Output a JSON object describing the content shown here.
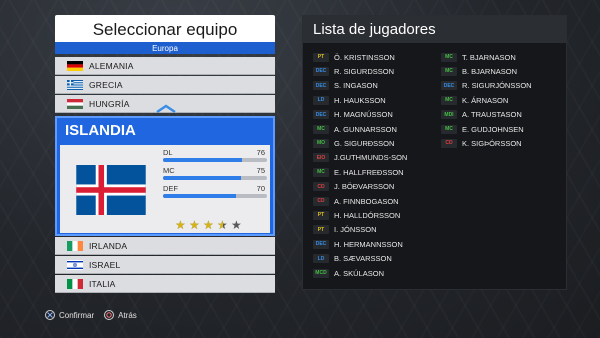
{
  "left_panel": {
    "title": "Seleccionar equipo",
    "region": "Europa",
    "teams_above": [
      {
        "name": "ALEMANIA",
        "flag": "germany"
      },
      {
        "name": "GRECIA",
        "flag": "greece"
      },
      {
        "name": "HUNGRÍA",
        "flag": "hungary"
      }
    ],
    "teams_below": [
      {
        "name": "IRLANDA",
        "flag": "ireland"
      },
      {
        "name": "ISRAEL",
        "flag": "israel"
      },
      {
        "name": "ITALIA",
        "flag": "italy"
      }
    ],
    "selected": {
      "name": "ISLANDIA",
      "flag": "iceland",
      "stats": [
        {
          "label": "DL",
          "value": "76",
          "level": 76
        },
        {
          "label": "MC",
          "value": "75",
          "level": 75
        },
        {
          "label": "DEF",
          "value": "70",
          "level": 70
        }
      ],
      "stars_rating": 3.5,
      "stars_max": 5
    }
  },
  "right_panel": {
    "title": "Lista de jugadores",
    "players_left": [
      {
        "pos": "PT",
        "name": "Ö. KRISTINSSON",
        "color": "#e0c020"
      },
      {
        "pos": "DEC",
        "name": "R. SIGURDSSON",
        "color": "#3a8ee6"
      },
      {
        "pos": "DEC",
        "name": "S. INGASON",
        "color": "#3a8ee6"
      },
      {
        "pos": "LD",
        "name": "H. HAUKSSON",
        "color": "#3a8ee6"
      },
      {
        "pos": "DEC",
        "name": "H. MAGNÚSSON",
        "color": "#3a8ee6"
      },
      {
        "pos": "MC",
        "name": "A. GUNNARSSON",
        "color": "#43c043"
      },
      {
        "pos": "MO",
        "name": "G. SIGURÐSSON",
        "color": "#43c043"
      },
      {
        "pos": "EIO",
        "name": "J.GUTHMUNDS-SON",
        "color": "#e04040"
      },
      {
        "pos": "MC",
        "name": "E. HALLFREÐSSON",
        "color": "#43c043"
      },
      {
        "pos": "CD",
        "name": "J. BÖÐVARSSON",
        "color": "#e04040"
      },
      {
        "pos": "CD",
        "name": "A. FINNBOGASON",
        "color": "#e04040"
      },
      {
        "pos": "PT",
        "name": "H. HALLDÓRSSON",
        "color": "#e0c020"
      },
      {
        "pos": "PT",
        "name": "I. JÓNSSON",
        "color": "#e0c020"
      },
      {
        "pos": "DEC",
        "name": "H. HERMANNSSON",
        "color": "#3a8ee6"
      },
      {
        "pos": "LD",
        "name": "B. SÆVARSSON",
        "color": "#3a8ee6"
      },
      {
        "pos": "MCD",
        "name": "A. SKÚLASON",
        "color": "#43c043"
      }
    ],
    "players_right": [
      {
        "pos": "MC",
        "name": "T. BJARNASON",
        "color": "#43c043"
      },
      {
        "pos": "MC",
        "name": "B. BJARNASON",
        "color": "#43c043"
      },
      {
        "pos": "DEC",
        "name": "R. SIGURJÓNSSON",
        "color": "#3a8ee6"
      },
      {
        "pos": "MC",
        "name": "K. ÁRNASON",
        "color": "#43c043"
      },
      {
        "pos": "MDI",
        "name": "A. TRAUSTASON",
        "color": "#43c043"
      },
      {
        "pos": "MC",
        "name": "E. GUDJOHNSEN",
        "color": "#43c043"
      },
      {
        "pos": "CD",
        "name": "K. SIGÞÓRSSON",
        "color": "#e04040"
      }
    ]
  },
  "footer": {
    "confirm_label": "Confirmar",
    "back_label": "Atrás"
  }
}
